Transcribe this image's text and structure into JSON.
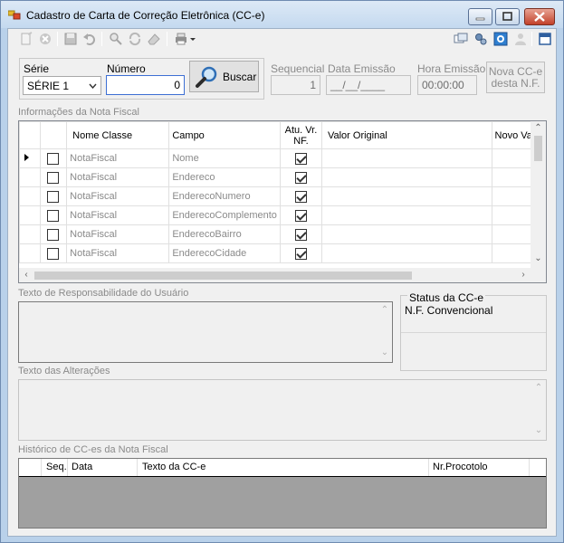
{
  "window": {
    "title": "Cadastro de Carta de Correção Eletrônica (CC-e)",
    "title_icon": "form-icon",
    "controls": [
      "minimize-icon",
      "maximize-icon",
      "close-icon"
    ]
  },
  "toolbar": {
    "left_icons": [
      "new-icon",
      "delete-icon",
      "save-icon",
      "undo-icon",
      "search-icon",
      "refresh-icon",
      "eraser-icon",
      "print-icon"
    ],
    "right_icons": [
      "window-icon",
      "tools-icon",
      "help-icon",
      "user-icon",
      "exit-icon"
    ]
  },
  "header": {
    "serie_label": "Série",
    "serie_value": "SÉRIE 1",
    "numero_label": "Número",
    "numero_value": "0",
    "buscar_label": "Buscar",
    "sequencial_label": "Sequencial",
    "sequencial_value": "1",
    "data_emissao_label": "Data Emissão",
    "data_emissao_value": "__/__/____",
    "hora_emissao_label": "Hora Emissão",
    "hora_emissao_value": "00:00:00",
    "nova_cce_label_1": "Nova CC-e",
    "nova_cce_label_2": "desta N.F."
  },
  "nota_fiscal": {
    "group_title": "Informações da Nota Fiscal",
    "columns": [
      "Nome Classe",
      "Campo",
      "Atu. Vr. NF.",
      "Valor Original",
      "Novo Va"
    ],
    "rows": [
      {
        "nome_classe": "NotaFiscal",
        "campo": "Nome",
        "atualiza": true
      },
      {
        "nome_classe": "NotaFiscal",
        "campo": "Endereco",
        "atualiza": true
      },
      {
        "nome_classe": "NotaFiscal",
        "campo": "EnderecoNumero",
        "atualiza": true
      },
      {
        "nome_classe": "NotaFiscal",
        "campo": "EnderecoComplemento",
        "atualiza": true
      },
      {
        "nome_classe": "NotaFiscal",
        "campo": "EnderecoBairro",
        "atualiza": true
      },
      {
        "nome_classe": "NotaFiscal",
        "campo": "EnderecoCidade",
        "atualiza": true
      }
    ]
  },
  "responsabilidade": {
    "group_title": "Texto de Responsabilidade do Usuário"
  },
  "status": {
    "title": "Status da CC-e",
    "value": "N.F. Convencional"
  },
  "alteracoes": {
    "group_title": "Texto das Alterações"
  },
  "historico": {
    "group_title": "Histórico de CC-es da Nota Fiscal",
    "columns": [
      "Seq.",
      "Data",
      "Texto da CC-e",
      "Nr.Procotolo"
    ]
  }
}
